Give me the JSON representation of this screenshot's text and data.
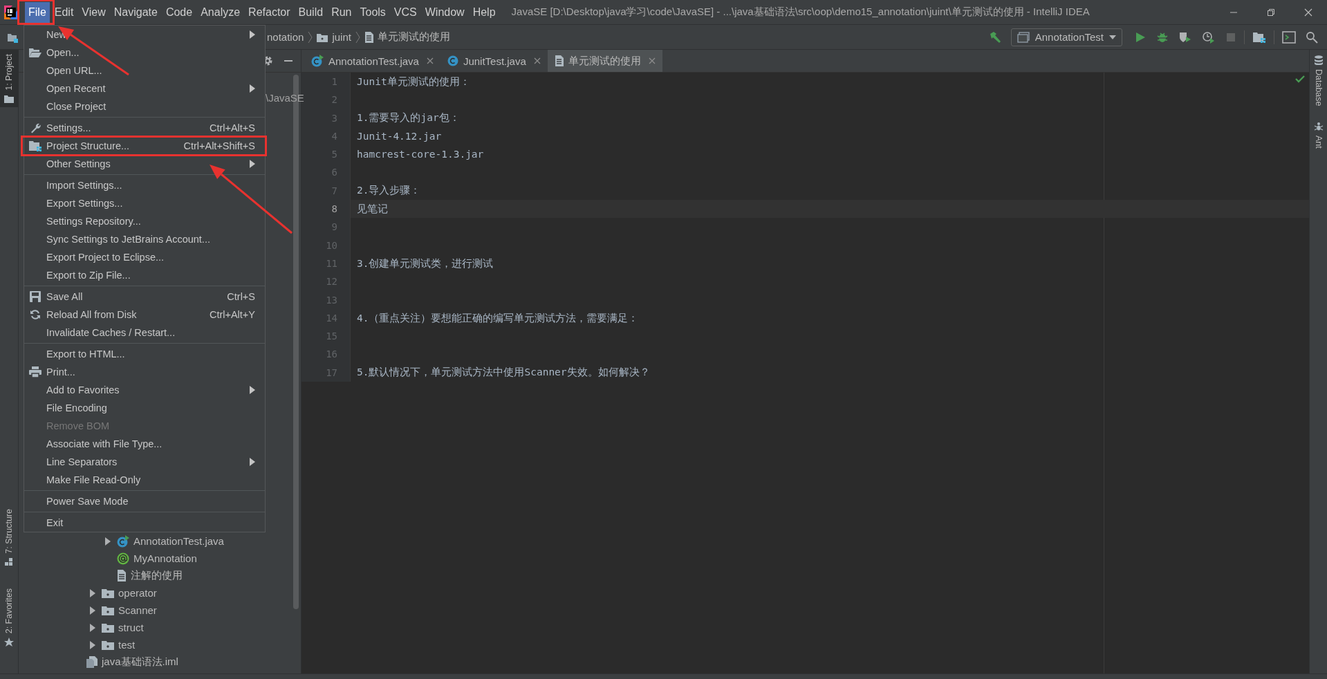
{
  "window": {
    "title": "JavaSE [D:\\Desktop\\java学习\\code\\JavaSE] - ...\\java基础语法\\src\\oop\\demo15_annotation\\juint\\单元测试的使用 - IntelliJ IDEA"
  },
  "menu_bar": [
    {
      "label": "File",
      "selected": true,
      "highlighted": true
    },
    {
      "label": "Edit",
      "selected": false,
      "highlighted": false
    },
    {
      "label": "View",
      "selected": false,
      "highlighted": false
    },
    {
      "label": "Navigate",
      "selected": false,
      "highlighted": false
    },
    {
      "label": "Code",
      "selected": false,
      "highlighted": false
    },
    {
      "label": "Analyze",
      "selected": false,
      "highlighted": false
    },
    {
      "label": "Refactor",
      "selected": false,
      "highlighted": false
    },
    {
      "label": "Build",
      "selected": false,
      "highlighted": false
    },
    {
      "label": "Run",
      "selected": false,
      "highlighted": false
    },
    {
      "label": "Tools",
      "selected": false,
      "highlighted": false
    },
    {
      "label": "VCS",
      "selected": false,
      "highlighted": false
    },
    {
      "label": "Window",
      "selected": false,
      "highlighted": false
    },
    {
      "label": "Help",
      "selected": false,
      "highlighted": false
    }
  ],
  "file_menu": {
    "groups": [
      {
        "items": [
          {
            "label": "New",
            "submenu": true,
            "disabled": false,
            "highlighted": false
          },
          {
            "label": "Open...",
            "submenu": false,
            "disabled": false,
            "highlighted": false
          },
          {
            "label": "Open URL...",
            "submenu": false,
            "disabled": false,
            "highlighted": false
          },
          {
            "label": "Open Recent",
            "submenu": true,
            "disabled": false,
            "highlighted": false
          },
          {
            "label": "Close Project",
            "submenu": false,
            "disabled": false,
            "highlighted": false
          }
        ]
      },
      {
        "items": [
          {
            "label": "Settings...",
            "shortcut": "Ctrl+Alt+S",
            "submenu": false,
            "disabled": false,
            "highlighted": false
          },
          {
            "label": "Project Structure...",
            "shortcut": "Ctrl+Alt+Shift+S",
            "submenu": false,
            "disabled": false,
            "highlighted": true
          },
          {
            "label": "Other Settings",
            "submenu": true,
            "disabled": false,
            "highlighted": false
          }
        ]
      },
      {
        "items": [
          {
            "label": "Import Settings...",
            "submenu": false,
            "disabled": false,
            "highlighted": false
          },
          {
            "label": "Export Settings...",
            "submenu": false,
            "disabled": false,
            "highlighted": false
          },
          {
            "label": "Settings Repository...",
            "submenu": false,
            "disabled": false,
            "highlighted": false
          },
          {
            "label": "Sync Settings to JetBrains Account...",
            "submenu": false,
            "disabled": false,
            "highlighted": false
          },
          {
            "label": "Export Project to Eclipse...",
            "submenu": false,
            "disabled": false,
            "highlighted": false
          },
          {
            "label": "Export to Zip File...",
            "submenu": false,
            "disabled": false,
            "highlighted": false
          }
        ]
      },
      {
        "items": [
          {
            "label": "Save All",
            "shortcut": "Ctrl+S",
            "submenu": false,
            "disabled": false,
            "highlighted": false
          },
          {
            "label": "Reload All from Disk",
            "shortcut": "Ctrl+Alt+Y",
            "submenu": false,
            "disabled": false,
            "highlighted": false
          },
          {
            "label": "Invalidate Caches / Restart...",
            "submenu": false,
            "disabled": false,
            "highlighted": false
          }
        ]
      },
      {
        "items": [
          {
            "label": "Export to HTML...",
            "submenu": false,
            "disabled": false,
            "highlighted": false
          },
          {
            "label": "Print...",
            "submenu": false,
            "disabled": false,
            "highlighted": false
          },
          {
            "label": "Add to Favorites",
            "submenu": true,
            "disabled": false,
            "highlighted": false
          },
          {
            "label": "File Encoding",
            "submenu": false,
            "disabled": false,
            "highlighted": false
          },
          {
            "label": "Remove BOM",
            "submenu": false,
            "disabled": true,
            "highlighted": false
          },
          {
            "label": "Associate with File Type...",
            "submenu": false,
            "disabled": false,
            "highlighted": false
          },
          {
            "label": "Line Separators",
            "submenu": true,
            "disabled": false,
            "highlighted": false
          },
          {
            "label": "Make File Read-Only",
            "submenu": false,
            "disabled": false,
            "highlighted": false
          }
        ]
      },
      {
        "items": [
          {
            "label": "Power Save Mode",
            "submenu": false,
            "disabled": false,
            "highlighted": false
          }
        ]
      },
      {
        "items": [
          {
            "label": "Exit",
            "submenu": false,
            "disabled": false,
            "highlighted": false
          }
        ]
      }
    ]
  },
  "navigation_bar": {
    "breadcrumbs": [
      {
        "label": "notation",
        "kind": "plain"
      },
      {
        "label": "juint",
        "kind": "folder"
      },
      {
        "label": "单元测试的使用",
        "kind": "text"
      }
    ],
    "run_configuration": "AnnotationTest"
  },
  "left_tool_strip": [
    {
      "label": "1: Project",
      "selected": true
    },
    {
      "label": "7: Structure",
      "selected": false
    },
    {
      "label": "2: Favorites",
      "selected": false
    }
  ],
  "right_tool_strip": [
    {
      "label": "Database"
    },
    {
      "label": "Ant"
    }
  ],
  "project_panel": {
    "root_fragment": "\\JavaSE",
    "tree": [
      {
        "children": [
          {
            "children": [
              {
                "label": "AnnotationTest.java",
                "kind": "runnable-class",
                "expanded": false
              },
              {
                "label": "MyAnnotation",
                "kind": "annotation"
              },
              {
                "label": "注解的使用",
                "kind": "text"
              }
            ]
          },
          {
            "label": "operator",
            "kind": "folder",
            "expanded": false
          },
          {
            "label": "Scanner",
            "kind": "folder",
            "expanded": false
          },
          {
            "label": "struct",
            "kind": "folder",
            "expanded": false
          },
          {
            "label": "test",
            "kind": "folder",
            "expanded": false
          }
        ]
      },
      {
        "label": "java基础语法.iml",
        "kind": "module-file"
      }
    ]
  },
  "editor_tabs": [
    {
      "label": "AnnotationTest.java",
      "kind": "runnable-class",
      "selected": false
    },
    {
      "label": "JunitTest.java",
      "kind": "class",
      "selected": false
    },
    {
      "label": "单元测试的使用",
      "kind": "text",
      "selected": true
    }
  ],
  "editor": {
    "lines": [
      {
        "number": "1",
        "text": "Junit单元测试的使用：",
        "selected": false
      },
      {
        "number": "2",
        "selected": false
      },
      {
        "number": "3",
        "text": "1.需要导入的jar包：",
        "selected": false
      },
      {
        "number": "4",
        "text": "Junit-4.12.jar",
        "selected": false
      },
      {
        "number": "5",
        "text": "hamcrest-core-1.3.jar",
        "selected": false
      },
      {
        "number": "6",
        "selected": false
      },
      {
        "number": "7",
        "text": "2.导入步骤：",
        "selected": false
      },
      {
        "number": "8",
        "text": "见笔记",
        "selected": true
      },
      {
        "number": "9",
        "selected": false
      },
      {
        "number": "10",
        "selected": false
      },
      {
        "number": "11",
        "text": "3.创建单元测试类，进行测试",
        "selected": false
      },
      {
        "number": "12",
        "selected": false
      },
      {
        "number": "13",
        "selected": false
      },
      {
        "number": "14",
        "text": "4.（重点关注）要想能正确的编写单元测试方法，需要满足：",
        "selected": false
      },
      {
        "number": "15",
        "selected": false
      },
      {
        "number": "16",
        "selected": false
      },
      {
        "number": "17",
        "text": "5.默认情况下，单元测试方法中使用Scanner失效。如何解决？",
        "selected": false
      }
    ]
  }
}
